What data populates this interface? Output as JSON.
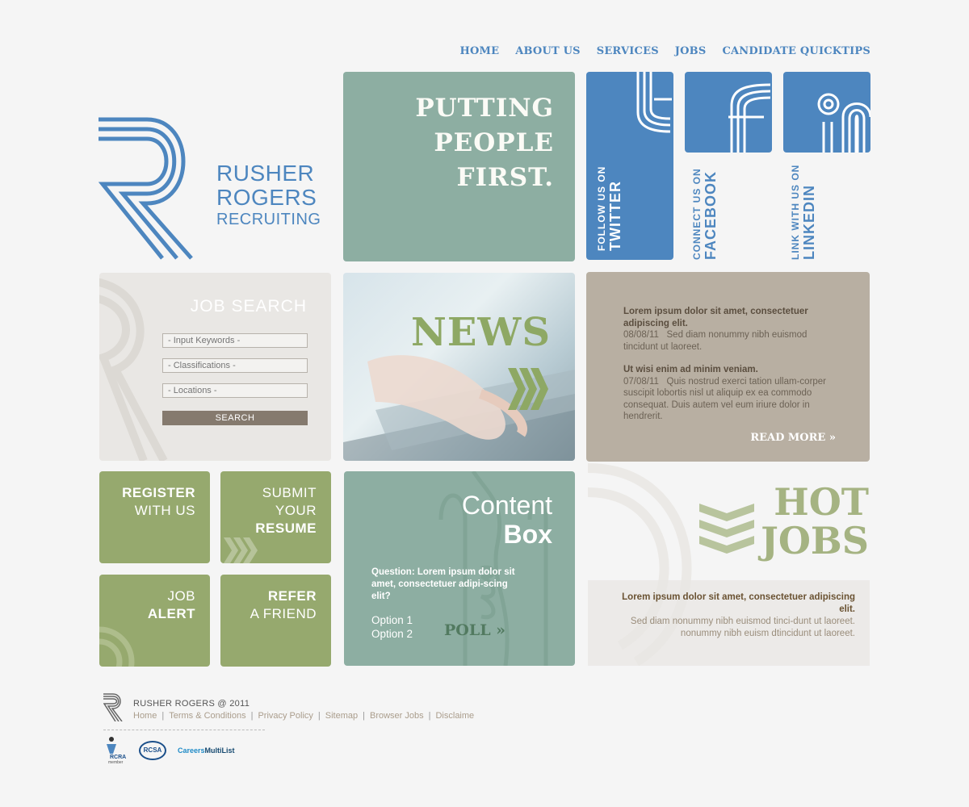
{
  "nav": [
    "HOME",
    "ABOUT US",
    "SERVICES",
    "JOBS",
    "CANDIDATE QUICKTIPS"
  ],
  "brand": {
    "line1": "RUSHER",
    "line2": "ROGERS",
    "line3": "RECRUITING"
  },
  "hero": {
    "line1": "PUTTING",
    "line2": "PEOPLE",
    "line3": "FIRST."
  },
  "social": {
    "twitter": {
      "small": "FOLLOW US ON",
      "big": "TWITTER"
    },
    "facebook": {
      "small": "CONNECT US ON",
      "big": "FACEBOOK"
    },
    "linkedin": {
      "small": "LINK WITH US ON",
      "big": "LINKEDIN"
    }
  },
  "job_search": {
    "title": "JOB SEARCH",
    "keywords_placeholder": "- Input Keywords -",
    "classifications_placeholder": "- Classifications -",
    "locations_placeholder": "- Locations -",
    "button": "SEARCH"
  },
  "news": {
    "title": "NEWS",
    "chevrons": "»",
    "items": [
      {
        "headline": "Lorem ipsum dolor sit amet, consectetuer adipiscing elit.",
        "date": "08/08/11",
        "body": "Sed diam nonummy nibh euismod tincidunt ut laoreet."
      },
      {
        "headline": "Ut wisi enim ad minim veniam.",
        "date": "07/08/11",
        "body": "Quis nostrud exerci tation ullam-corper suscipit lobortis nisl ut aliquip ex ea commodo consequat. Duis autem vel eum iriure dolor in hendrerit."
      }
    ],
    "read_more": "READ MORE »"
  },
  "tiles": {
    "register": {
      "a": "REGISTER",
      "b": "WITH US"
    },
    "submit": {
      "a": "SUBMIT",
      "b": "YOUR",
      "c": "RESUME"
    },
    "job_alert": {
      "a": "JOB",
      "b": "ALERT"
    },
    "refer": {
      "a": "REFER",
      "b": "A FRIEND"
    }
  },
  "content_box": {
    "title1": "Content",
    "title2": "Box",
    "question": "Question: Lorem ipsum dolor sit amet, consectetuer adipi-scing elit?",
    "option1": "Option 1",
    "option2": "Option 2",
    "poll": "POLL »"
  },
  "hot_jobs": {
    "line1": "HOT",
    "line2": "JOBS",
    "headline": "Lorem ipsum dolor sit amet, consectetuer adipiscing elit.",
    "body": "Sed diam nonummy nibh euismod tinci-dunt ut laoreet. nonummy nibh euism dtincidunt ut laoreet."
  },
  "footer": {
    "brand": "RUSHER ROGERS @ 2011",
    "links": [
      "Home",
      "Terms & Conditions",
      "Privacy Policy",
      "Sitemap",
      "Browser Jobs",
      "Disclaime"
    ],
    "badges": {
      "rcra": "RCRA",
      "rcra_sub": "member",
      "rcsa": "RCSA",
      "cml_a": "Careers",
      "cml_b": "MultiList"
    }
  },
  "colors": {
    "blue": "#4d86bf",
    "teal": "#8daea2",
    "taupe": "#b8afa2",
    "green": "#96a96e"
  }
}
